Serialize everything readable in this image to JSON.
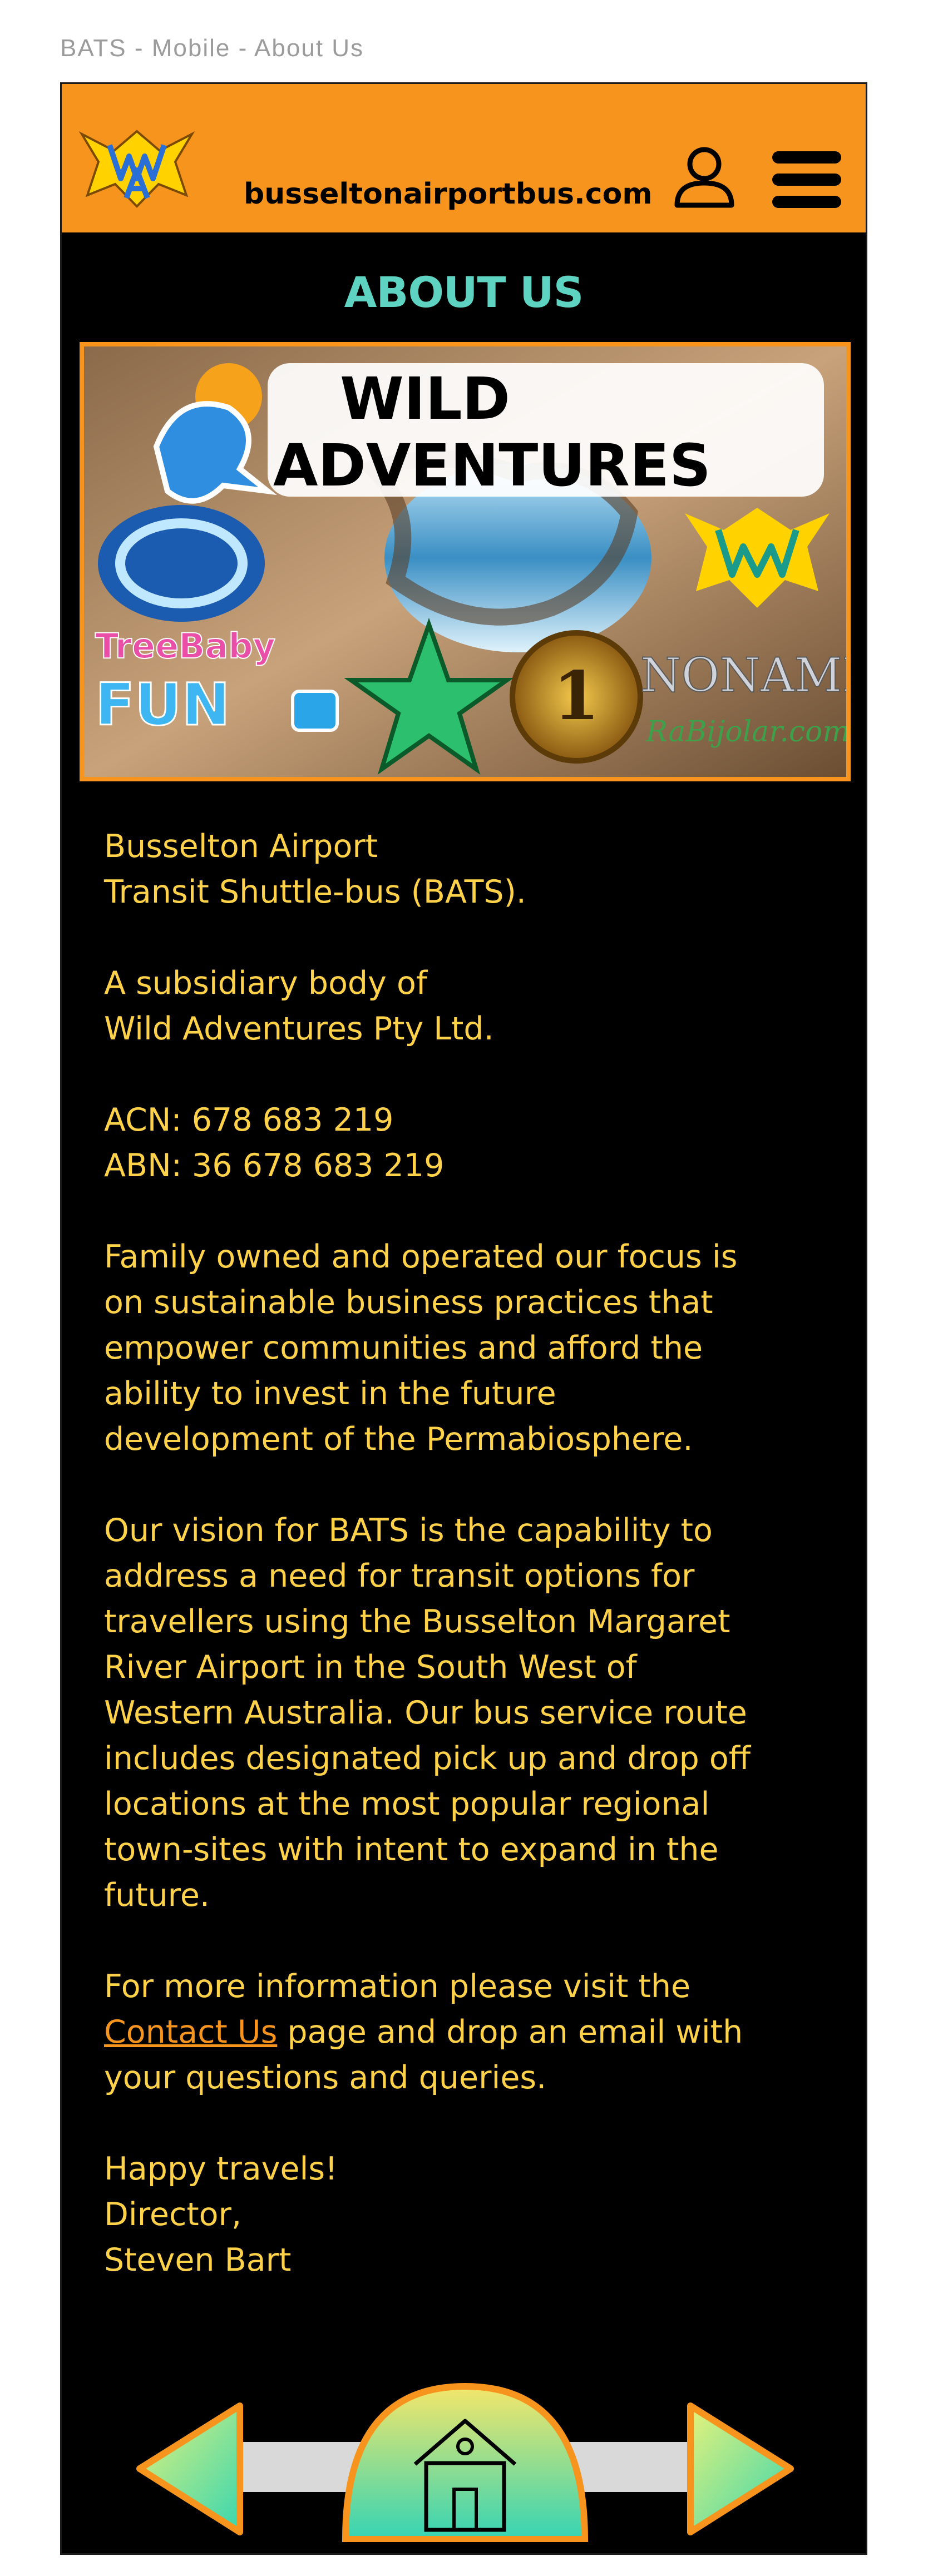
{
  "caption": "BATS - Mobile - About Us",
  "header": {
    "site_url": "busseltonairportbus.com",
    "logo_icon": "wa-bat-logo-icon",
    "account_icon": "user-icon",
    "menu_icon": "hamburger-menu-icon",
    "background": "#f7941d"
  },
  "about": {
    "title": "ABOUT US",
    "banner": {
      "headline_1": "WILD",
      "headline_2": "ADVENTURES",
      "treebaby_1": "TreeBaby",
      "treebaby_2": "FUN",
      "noname_1": "NONAME",
      "noname_2": "RaBijolar.com",
      "coin_label": "1"
    },
    "paragraphs": [
      {
        "lines": [
          "Busselton Airport",
          "Transit Shuttle-bus (BATS)."
        ]
      },
      {
        "lines": [
          "A subsidiary body of",
          "Wild Adventures Pty Ltd."
        ]
      },
      {
        "lines": [
          "ACN: 678 683 219",
          "ABN: 36 678 683 219"
        ]
      },
      {
        "lines": [
          "Family owned and operated our focus is",
          "on sustainable business practices that",
          "empower communities and afford the",
          "ability to invest in the future",
          "development of the Permabiosphere."
        ]
      },
      {
        "lines": [
          "Our vision for BATS is the capability to",
          "address a need for transit options for",
          "travellers using the Busselton Margaret",
          "River Airport in the South West of",
          "Western Australia. Our bus service route",
          "includes designated pick up and drop off",
          "locations at the most popular regional",
          "town-sites with intent to expand in the",
          "future."
        ]
      }
    ],
    "contact_para": {
      "line1": "For more information please visit the",
      "link_text": "Contact Us",
      "line2_rest": " page and drop an email with",
      "line3": "your questions and queries."
    },
    "signoff": [
      "Happy travels!",
      "Director,",
      "Steven Bart"
    ]
  },
  "footer": {
    "prev_icon": "arrow-left-icon",
    "home_icon": "home-icon",
    "next_icon": "arrow-right-icon"
  },
  "colors": {
    "accent": "#f7941d",
    "title": "#5fd3c2",
    "text": "#ffd24a",
    "background": "#000000"
  }
}
